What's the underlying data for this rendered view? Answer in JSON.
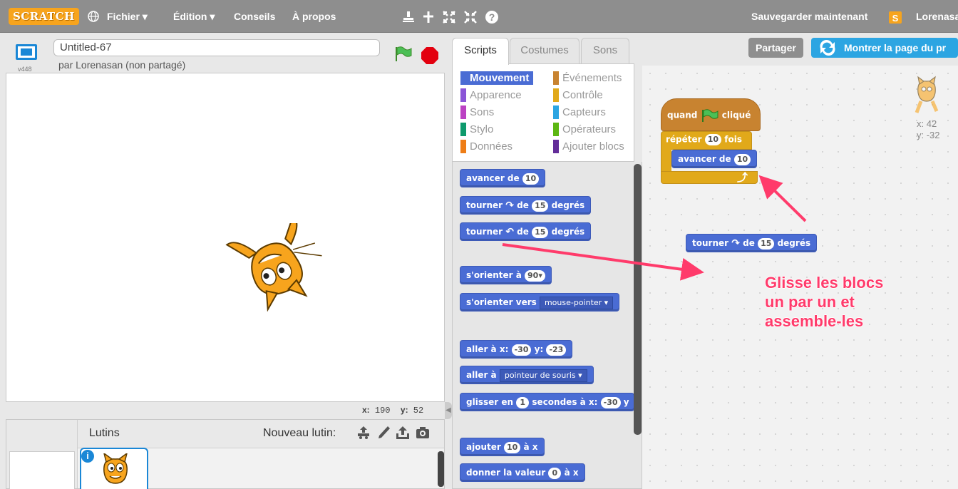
{
  "menubar": {
    "logo": "SCRATCH",
    "items": [
      "Fichier ▾",
      "Édition ▾",
      "Conseils",
      "À propos"
    ],
    "save_now": "Sauvegarder maintenant",
    "username": "Lorenasan"
  },
  "stage_header": {
    "version": "v448",
    "title": "Untitled-67",
    "byline": "par Lorenasan (non partagé)"
  },
  "stage": {
    "coords_x_label": "x:",
    "coords_x": "190",
    "coords_y_label": "y:",
    "coords_y": "52"
  },
  "sprites": {
    "title": "Lutins",
    "new_sprite": "Nouveau lutin:",
    "info_icon": "i"
  },
  "tabs": [
    "Scripts",
    "Costumes",
    "Sons"
  ],
  "categories": {
    "left": [
      "Mouvement",
      "Apparence",
      "Sons",
      "Stylo",
      "Données"
    ],
    "right": [
      "Événements",
      "Contrôle",
      "Capteurs",
      "Opérateurs",
      "Ajouter blocs"
    ],
    "colors_left": [
      "#4a6cd4",
      "#8a55d7",
      "#bb42c3",
      "#0e9a6c",
      "#ee7d16"
    ],
    "colors_right": [
      "#c88330",
      "#e1a91a",
      "#2ca5e2",
      "#5cb712",
      "#632d99"
    ]
  },
  "palette": {
    "move": "avancer de",
    "move_val": "10",
    "turn_cw_a": "tourner",
    "turn_cw_b": "de",
    "turn_val": "15",
    "degrees": "degrés",
    "turn_ccw_a": "tourner",
    "turn_ccw_b": "de",
    "turn_ccw_val": "15",
    "degrees2": "degrés",
    "point_dir": "s'orienter à",
    "point_dir_val": "90▾",
    "point_towards": "s'orienter vers",
    "point_towards_val": "mouse-pointer ▾",
    "goto_a": "aller à x:",
    "goto_x": "-30",
    "goto_b": "y:",
    "goto_y": "-23",
    "goto_target": "aller à",
    "goto_target_val": "pointeur de souris ▾",
    "glide_a": "glisser en",
    "glide_secs": "1",
    "glide_b": "secondes à x:",
    "glide_x": "-30",
    "glide_c": "y",
    "change_x": "ajouter",
    "change_x_val": "10",
    "change_x_b": "à x",
    "set_x": "donner la valeur",
    "set_x_val": "0",
    "set_x_b": "à x"
  },
  "top_right": {
    "share": "Partager",
    "see_page": "Montrer la page du pr"
  },
  "workspace": {
    "hat_a": "quand",
    "hat_b": "cliqué",
    "repeat_a": "répéter",
    "repeat_val": "10",
    "repeat_b": "fois",
    "inner_move": "avancer de",
    "inner_move_val": "10",
    "loose_turn_a": "tourner",
    "loose_turn_b": "de",
    "loose_turn_val": "15",
    "loose_turn_c": "degrés",
    "sprite_x": "x: 42",
    "sprite_y": "y: -32"
  },
  "instruction": [
    "Glisse les blocs",
    "un par un et",
    "assemble-les"
  ],
  "colors": {
    "motion": "#4a6cd4",
    "control": "#e1a91a",
    "events": "#c88330",
    "arrow": "#ff3b6b",
    "accent": "#1a87d6"
  }
}
